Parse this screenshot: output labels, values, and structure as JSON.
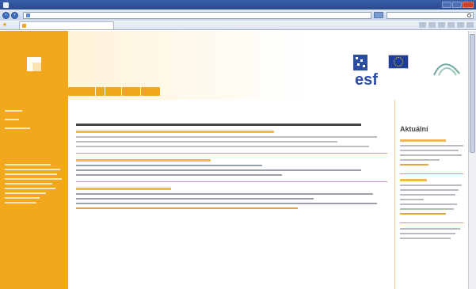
{
  "browser": {
    "window_title": "",
    "address": "",
    "tab_title": ""
  },
  "colors": {
    "brand_orange": "#f2a81d",
    "link": "#e6a23c",
    "chrome_blue": "#3a5fa8"
  },
  "icons": [
    "back-icon",
    "forward-icon",
    "search-icon",
    "favorites-star-icon",
    "home-icon"
  ],
  "header": {
    "tagline": ""
  },
  "sidebar_right": {
    "heading": "Aktuální"
  }
}
